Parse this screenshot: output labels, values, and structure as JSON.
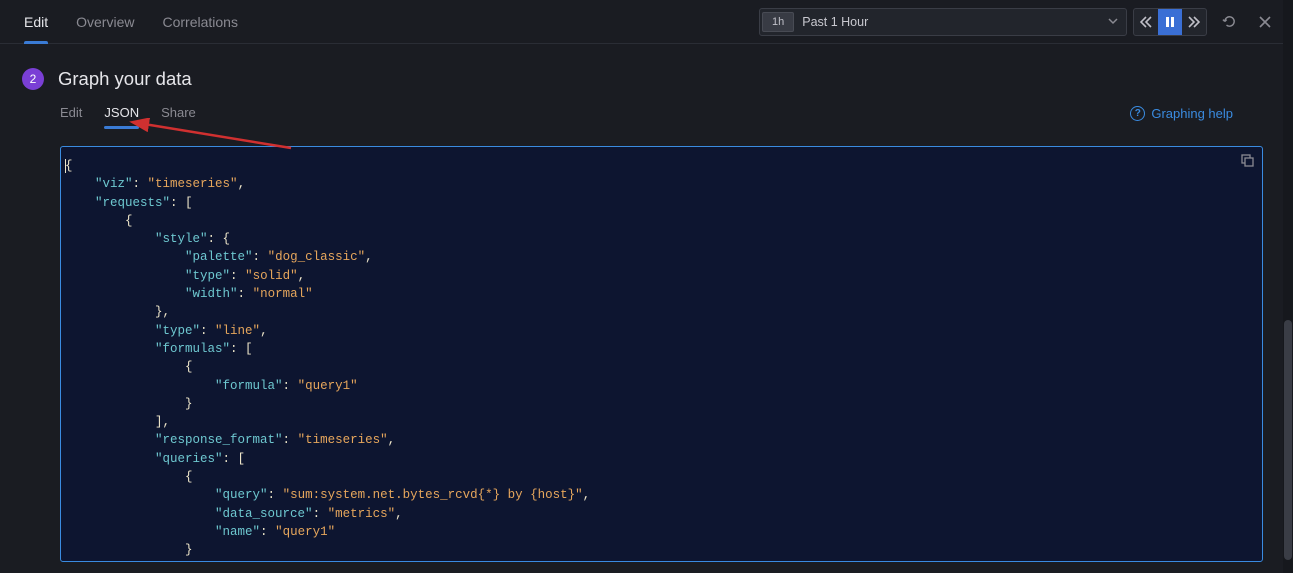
{
  "top_tabs": {
    "t0": "Edit",
    "t1": "Overview",
    "t2": "Correlations"
  },
  "time": {
    "badge": "1h",
    "label": "Past 1 Hour"
  },
  "step": {
    "number": "2",
    "title": "Graph your data"
  },
  "sub_tabs": {
    "s0": "Edit",
    "s1": "JSON",
    "s2": "Share"
  },
  "help": {
    "label": "Graphing help"
  },
  "code_json": {
    "viz": "timeseries",
    "requests": [
      {
        "style": {
          "palette": "dog_classic",
          "type": "solid",
          "width": "normal"
        },
        "type": "line",
        "formulas": [
          {
            "formula": "query1"
          }
        ],
        "response_format": "timeseries",
        "queries": [
          {
            "query": "sum:system.net.bytes_rcvd{*} by {host}",
            "data_source": "metrics",
            "name": "query1"
          }
        ]
      }
    ]
  }
}
